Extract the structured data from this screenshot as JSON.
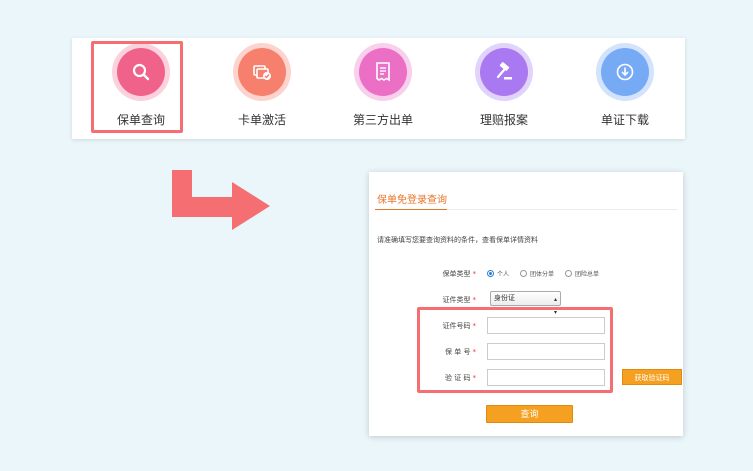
{
  "nav": {
    "items": [
      {
        "label": "保单查询",
        "icon": "search-icon",
        "color": "#f0628a",
        "ring": "#fbd1dd"
      },
      {
        "label": "卡单激活",
        "icon": "card-check-icon",
        "color": "#f77f6e",
        "ring": "#fcd4cd"
      },
      {
        "label": "第三方出单",
        "icon": "receipt-icon",
        "color": "#ec6fc6",
        "ring": "#f9d0ec"
      },
      {
        "label": "理赔报案",
        "icon": "gavel-icon",
        "color": "#a879f0",
        "ring": "#e2d3fb"
      },
      {
        "label": "单证下载",
        "icon": "download-icon",
        "color": "#77aaf5",
        "ring": "#d3e3fc"
      }
    ]
  },
  "form": {
    "title": "保单免登录查询",
    "description": "请准确填写您要查询资料的条件，查看保单详情资料",
    "policy_type_label": "保单类型",
    "policy_type_options": [
      "个人",
      "团体分单",
      "团险总单"
    ],
    "policy_type_selected": "个人",
    "id_type_label": "证件类型",
    "id_type_value": "身份证",
    "id_number_label": "证件号码",
    "policy_no_label": "保 单 号",
    "captcha_label": "验 证 码",
    "required_mark": "*",
    "get_code_button": "获取验证码",
    "query_button": "查询"
  },
  "colors": {
    "accent": "#f6a022",
    "title": "#e8742a",
    "highlight": "#f56f72",
    "background": "#eaf6fa"
  }
}
